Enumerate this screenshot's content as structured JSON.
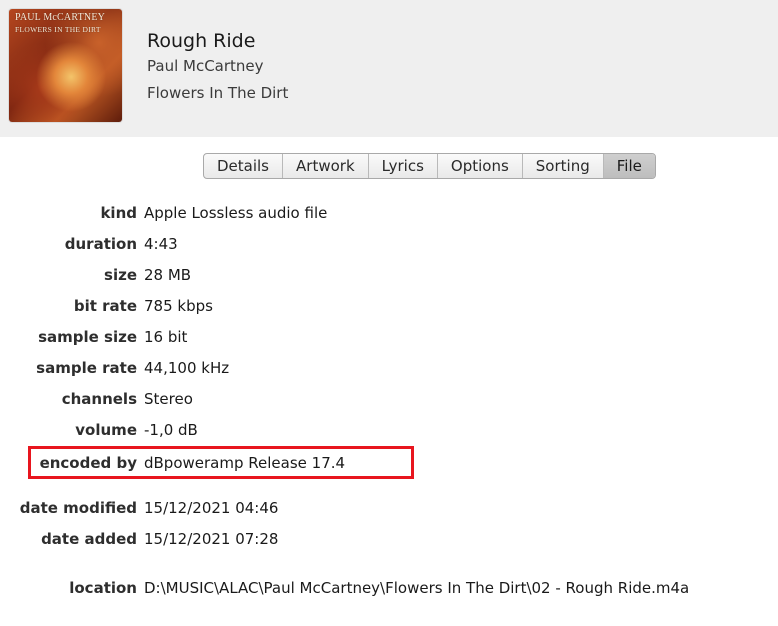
{
  "header": {
    "title": "Rough Ride",
    "artist": "Paul McCartney",
    "album": "Flowers In The Dirt",
    "artwork": {
      "line1": "PAUL McCARTNEY",
      "line2": "FLOWERS IN THE DIRT"
    }
  },
  "tabs": [
    {
      "label": "Details",
      "active": false
    },
    {
      "label": "Artwork",
      "active": false
    },
    {
      "label": "Lyrics",
      "active": false
    },
    {
      "label": "Options",
      "active": false
    },
    {
      "label": "Sorting",
      "active": false
    },
    {
      "label": "File",
      "active": true
    }
  ],
  "file_info": {
    "kind": {
      "label": "kind",
      "value": "Apple Lossless audio file"
    },
    "duration": {
      "label": "duration",
      "value": "4:43"
    },
    "size": {
      "label": "size",
      "value": "28 MB"
    },
    "bit_rate": {
      "label": "bit rate",
      "value": "785 kbps"
    },
    "sample_size": {
      "label": "sample size",
      "value": "16 bit"
    },
    "sample_rate": {
      "label": "sample rate",
      "value": "44,100 kHz"
    },
    "channels": {
      "label": "channels",
      "value": "Stereo"
    },
    "volume": {
      "label": "volume",
      "value": "-1,0 dB"
    },
    "encoded_by": {
      "label": "encoded by",
      "value": "dBpoweramp Release 17.4"
    },
    "date_modified": {
      "label": "date modified",
      "value": "15/12/2021 04:46"
    },
    "date_added": {
      "label": "date added",
      "value": "15/12/2021 07:28"
    },
    "location": {
      "label": "location",
      "value": "D:\\MUSIC\\ALAC\\Paul McCartney\\Flowers In The Dirt\\02 - Rough Ride.m4a"
    }
  },
  "colors": {
    "highlight_box": "#e8151e",
    "header_background": "#efefef"
  }
}
